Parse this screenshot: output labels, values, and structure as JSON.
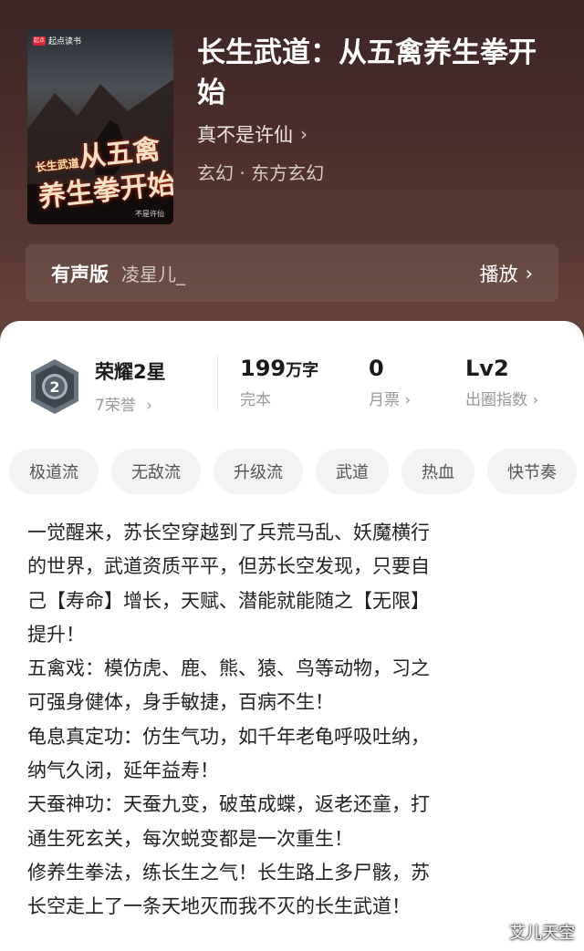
{
  "cover": {
    "publisher": "起点读书",
    "publisher_logo": "起点",
    "title_line1": "从五禽",
    "title_line2": "养生拳开始",
    "title_prefix": "长生武道",
    "author": "不是许仙"
  },
  "book": {
    "title": "长生武道：从五禽养生拳开始",
    "author": "真不是许仙",
    "genre": "玄幻 · 东方玄幻"
  },
  "audio": {
    "label": "有声版",
    "narrator": "凌星儿_",
    "play": "播放"
  },
  "honor": {
    "title": "荣耀2星",
    "sub": "7荣誉",
    "badge_num": "2"
  },
  "stats": {
    "words_value": "199",
    "words_unit": "万字",
    "words_label": "完本",
    "ticket_value": "0",
    "ticket_label": "月票",
    "level_value": "Lv2",
    "level_label": "出圈指数"
  },
  "tags": [
    "极道流",
    "无敌流",
    "升级流",
    "武道",
    "热血",
    "快节奏"
  ],
  "description": [
    "一觉醒来，苏长空穿越到了兵荒马乱、妖魔横行",
    "的世界，武道资质平平，但苏长空发现，只要自",
    "己【寿命】增长，天赋、潜能就能随之【无限】",
    "提升！",
    "五禽戏：模仿虎、鹿、熊、猿、鸟等动物，习之",
    "可强身健体，身手敏捷，百病不生！",
    "龟息真定功：仿生气功，如千年老龟呼吸吐纳，",
    "纳气久闭，延年益寿！",
    "天蚕神功：天蚕九变，破茧成蝶，返老还童，打",
    "通生死玄关，每次蜕变都是一次重生！",
    "修养生拳法，练长生之气！长生路上多尸骸，苏",
    "长空走上了一条天地灭而我不灭的长生武道！"
  ],
  "watermark": "艾儿天空",
  "chevron": "›"
}
